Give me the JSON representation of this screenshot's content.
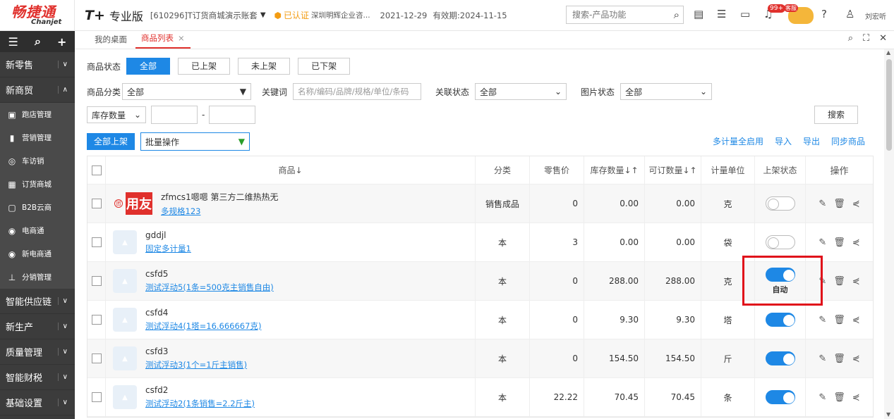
{
  "brand": {
    "cn": "畅捷通",
    "en": "Chanjet"
  },
  "header": {
    "product": "T+",
    "edition": "专业版",
    "account": "[610296]T订货商城演示账套",
    "verified": "已认证",
    "company": "深圳明辉企业咨...",
    "date": "2021-12-29",
    "valid": "有效期:2024-11-15",
    "search_placeholder": "搜索-产品功能",
    "notify_badge": "99+",
    "mascot_label": "客服",
    "user": "刘宏听"
  },
  "sidebar": {
    "groups_top": [
      {
        "label": "新零售",
        "expanded": false
      },
      {
        "label": "新商贸",
        "expanded": true
      }
    ],
    "sub_items": [
      {
        "label": "跑店管理",
        "icon": "store-icon"
      },
      {
        "label": "营销管理",
        "icon": "chart-icon"
      },
      {
        "label": "车访销",
        "icon": "car-icon"
      },
      {
        "label": "订货商城",
        "icon": "shop-icon"
      },
      {
        "label": "B2B云商",
        "icon": "lock-icon"
      },
      {
        "label": "电商通",
        "icon": "circle-icon"
      },
      {
        "label": "新电商通",
        "icon": "circle-icon"
      },
      {
        "label": "分销管理",
        "icon": "tree-icon"
      }
    ],
    "groups_bottom": [
      "智能供应链",
      "新生产",
      "质量管理",
      "智能财税",
      "基础设置"
    ]
  },
  "tabs": [
    {
      "label": "我的桌面",
      "active": false
    },
    {
      "label": "商品列表",
      "active": true
    }
  ],
  "filters": {
    "status_label": "商品状态",
    "status_options": [
      "全部",
      "已上架",
      "未上架",
      "已下架"
    ],
    "category_label": "商品分类",
    "category_value": "全部",
    "keyword_label": "关键词",
    "keyword_placeholder": "名称/编码/品牌/规格/单位/条码",
    "link_label": "关联状态",
    "link_value": "全部",
    "image_label": "图片状态",
    "image_value": "全部",
    "stock_select": "库存数量",
    "range_sep": "-",
    "search_btn": "搜索"
  },
  "actions": {
    "all_on_shelf": "全部上架",
    "batch": "批量操作",
    "links": [
      "多计量全启用",
      "导入",
      "导出",
      "同步商品"
    ]
  },
  "table": {
    "headers": {
      "product": "商品↓",
      "category": "分类",
      "price": "零售价",
      "stock": "库存数量↓↑",
      "orderable": "可订数量↓↑",
      "unit": "计量单位",
      "status": "上架状态",
      "ops": "操作"
    },
    "rows": [
      {
        "name": "zfmcs1嗯嗯 第三方二维热热无",
        "spec": "多规格123",
        "category": "销售成品",
        "price": "0",
        "stock": "0.00",
        "orderable": "0.00",
        "unit": "克",
        "on": false,
        "brand_thumb": "用友",
        "stamp": "团",
        "auto": ""
      },
      {
        "name": "gddjl",
        "spec": "固定多计量1",
        "category": "本",
        "price": "3",
        "stock": "0.00",
        "orderable": "0.00",
        "unit": "袋",
        "on": false,
        "auto": ""
      },
      {
        "name": "csfd5",
        "spec": "测试浮动5(1条=500克主销售自由)",
        "category": "本",
        "price": "0",
        "stock": "288.00",
        "orderable": "288.00",
        "unit": "克",
        "on": true,
        "auto": "自动"
      },
      {
        "name": "csfd4",
        "spec": "测试浮动4(1塔=16.666667克)",
        "category": "本",
        "price": "0",
        "stock": "9.30",
        "orderable": "9.30",
        "unit": "塔",
        "on": true,
        "auto": ""
      },
      {
        "name": "csfd3",
        "spec": "测试浮动3(1个=1斤主销售)",
        "category": "本",
        "price": "0",
        "stock": "154.50",
        "orderable": "154.50",
        "unit": "斤",
        "on": true,
        "auto": ""
      },
      {
        "name": "csfd2",
        "spec": "测试浮动2(1条销售=2.2斤主)",
        "category": "本",
        "price": "22.22",
        "stock": "70.45",
        "orderable": "70.45",
        "unit": "条",
        "on": true,
        "auto": ""
      }
    ]
  }
}
